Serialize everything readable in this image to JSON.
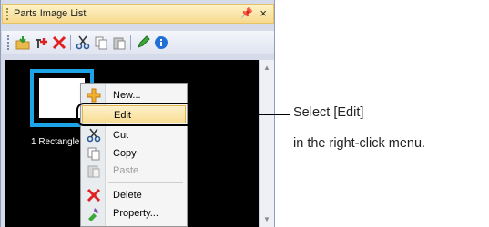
{
  "panel": {
    "title": "Parts Image List",
    "pin_glyph": "↕",
    "close_glyph": "×"
  },
  "toolbar": {
    "buttons": [
      {
        "name": "import-image",
        "icon": "folder-arrow-icon"
      },
      {
        "name": "add-part",
        "icon": "add-part-icon"
      },
      {
        "name": "delete",
        "icon": "delete-x-icon"
      },
      {
        "name": "cut",
        "icon": "scissors-icon"
      },
      {
        "name": "copy",
        "icon": "copy-icon"
      },
      {
        "name": "paste",
        "icon": "paste-icon"
      },
      {
        "name": "edit",
        "icon": "pencil-icon"
      },
      {
        "name": "property",
        "icon": "info-icon"
      }
    ]
  },
  "parts": [
    {
      "label": "1 Rectangle"
    }
  ],
  "context_menu": {
    "items": [
      {
        "label": "New...",
        "icon": "new-icon",
        "enabled": true,
        "highlighted": false
      },
      {
        "label": "Edit",
        "icon": "none",
        "enabled": true,
        "highlighted": true
      },
      {
        "label": "Cut",
        "icon": "scissors-icon",
        "enabled": true,
        "highlighted": false
      },
      {
        "label": "Copy",
        "icon": "copy-icon",
        "enabled": true,
        "highlighted": false
      },
      {
        "label": "Paste",
        "icon": "paste-icon",
        "enabled": false,
        "highlighted": false
      },
      {
        "label": "Delete",
        "icon": "delete-x-icon",
        "enabled": true,
        "highlighted": false
      },
      {
        "label": "Property...",
        "icon": "property-icon",
        "enabled": true,
        "highlighted": false
      }
    ]
  },
  "callout": {
    "line1": "Select [Edit]",
    "line2": "in the right-click menu."
  },
  "colors": {
    "title_bar": "#f7d98e",
    "selection_border": "#1ca3e8",
    "delete_red": "#e02020",
    "highlight": "#f8dd94"
  }
}
